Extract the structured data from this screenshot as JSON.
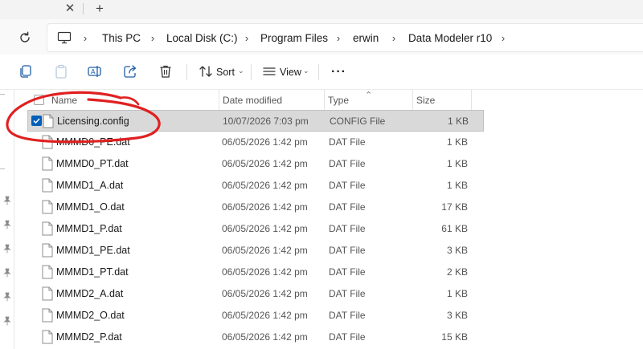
{
  "tabs": {
    "close_icon": "close-icon",
    "new_icon": "plus-icon",
    "close_glyph": "✕",
    "new_glyph": "+"
  },
  "breadcrumb": {
    "items": [
      "This PC",
      "Local Disk (C:)",
      "Program Files",
      "erwin",
      "Data Modeler r10"
    ],
    "separator": "›"
  },
  "toolbar": {
    "sort_label": "Sort",
    "view_label": "View",
    "more_label": "···"
  },
  "columns": {
    "name": "Name",
    "date_modified": "Date modified",
    "type": "Type",
    "size": "Size"
  },
  "files": [
    {
      "name": "Licensing.config",
      "date": "10/07/2026 7:03 pm",
      "type": "CONFIG File",
      "size": "1 KB",
      "selected": true
    },
    {
      "name": "MMMD0_PE.dat",
      "date": "06/05/2026 1:42 pm",
      "type": "DAT File",
      "size": "1 KB"
    },
    {
      "name": "MMMD0_PT.dat",
      "date": "06/05/2026 1:42 pm",
      "type": "DAT File",
      "size": "1 KB"
    },
    {
      "name": "MMMD1_A.dat",
      "date": "06/05/2026 1:42 pm",
      "type": "DAT File",
      "size": "1 KB"
    },
    {
      "name": "MMMD1_O.dat",
      "date": "06/05/2026 1:42 pm",
      "type": "DAT File",
      "size": "17 KB"
    },
    {
      "name": "MMMD1_P.dat",
      "date": "06/05/2026 1:42 pm",
      "type": "DAT File",
      "size": "61 KB"
    },
    {
      "name": "MMMD1_PE.dat",
      "date": "06/05/2026 1:42 pm",
      "type": "DAT File",
      "size": "3 KB"
    },
    {
      "name": "MMMD1_PT.dat",
      "date": "06/05/2026 1:42 pm",
      "type": "DAT File",
      "size": "2 KB"
    },
    {
      "name": "MMMD2_A.dat",
      "date": "06/05/2026 1:42 pm",
      "type": "DAT File",
      "size": "1 KB"
    },
    {
      "name": "MMMD2_O.dat",
      "date": "06/05/2026 1:42 pm",
      "type": "DAT File",
      "size": "3 KB"
    },
    {
      "name": "MMMD2_P.dat",
      "date": "06/05/2026 1:42 pm",
      "type": "DAT File",
      "size": "15 KB"
    }
  ],
  "colors": {
    "accent": "#005fb8",
    "annotation": "#e02020",
    "selected_row": "#d9d9d9"
  }
}
